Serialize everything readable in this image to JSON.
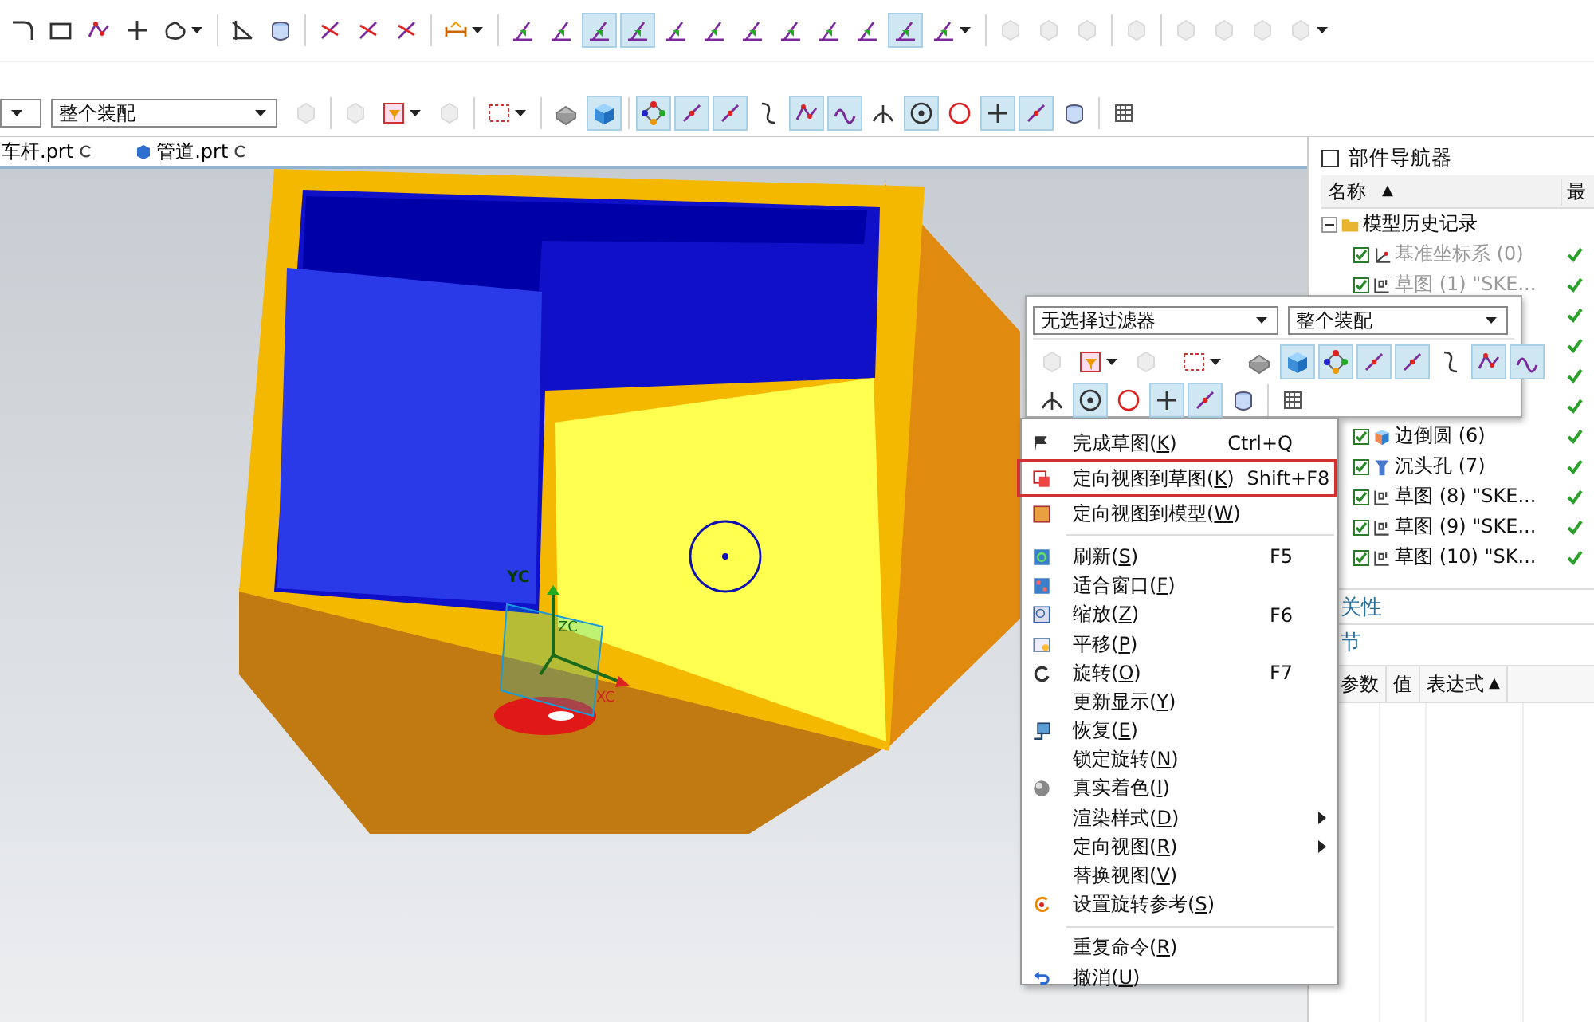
{
  "toolbar": [
    {
      "kind": "corner",
      "pressed": false,
      "disabled": false,
      "menu": false
    },
    {
      "kind": "rect",
      "pressed": false,
      "disabled": false,
      "menu": false
    },
    {
      "kind": "polyline",
      "pressed": false,
      "disabled": false,
      "menu": false
    },
    {
      "kind": "plus",
      "pressed": false,
      "disabled": false,
      "menu": false
    },
    {
      "kind": "blob",
      "pressed": false,
      "disabled": false,
      "menu": true
    },
    {
      "kind": "separator"
    },
    {
      "kind": "angle",
      "pressed": false,
      "disabled": false,
      "menu": false
    },
    {
      "kind": "cylinder",
      "pressed": false,
      "disabled": false,
      "menu": false
    },
    {
      "kind": "separator"
    },
    {
      "kind": "trim",
      "pressed": false,
      "disabled": false,
      "menu": false
    },
    {
      "kind": "trim",
      "pressed": false,
      "disabled": false,
      "menu": false
    },
    {
      "kind": "trim",
      "pressed": false,
      "disabled": false,
      "menu": false
    },
    {
      "kind": "separator"
    },
    {
      "kind": "dimension",
      "pressed": false,
      "disabled": false,
      "menu": true
    },
    {
      "kind": "separator"
    },
    {
      "kind": "sketch",
      "pressed": false,
      "disabled": false,
      "menu": false
    },
    {
      "kind": "sketch",
      "pressed": false,
      "disabled": false,
      "menu": false
    },
    {
      "kind": "sketch",
      "pressed": true,
      "disabled": false,
      "menu": false
    },
    {
      "kind": "sketch",
      "pressed": true,
      "disabled": false,
      "menu": false
    },
    {
      "kind": "sketch",
      "pressed": false,
      "disabled": false,
      "menu": false
    },
    {
      "kind": "sketch",
      "pressed": false,
      "disabled": false,
      "menu": false
    },
    {
      "kind": "sketch",
      "pressed": false,
      "disabled": false,
      "menu": false
    },
    {
      "kind": "sketch",
      "pressed": false,
      "disabled": false,
      "menu": false
    },
    {
      "kind": "sketch",
      "pressed": false,
      "disabled": false,
      "menu": false
    },
    {
      "kind": "sketch",
      "pressed": false,
      "disabled": false,
      "menu": false
    },
    {
      "kind": "sketch",
      "pressed": true,
      "disabled": false,
      "menu": false
    },
    {
      "kind": "sketch",
      "pressed": false,
      "disabled": false,
      "menu": true
    },
    {
      "kind": "separator"
    },
    {
      "kind": "part",
      "pressed": false,
      "disabled": true,
      "menu": false
    },
    {
      "kind": "part",
      "pressed": false,
      "disabled": true,
      "menu": false
    },
    {
      "kind": "part",
      "pressed": false,
      "disabled": true,
      "menu": false
    },
    {
      "kind": "separator"
    },
    {
      "kind": "part",
      "pressed": false,
      "disabled": true,
      "menu": false
    },
    {
      "kind": "separator"
    },
    {
      "kind": "part",
      "pressed": false,
      "disabled": true,
      "menu": false
    },
    {
      "kind": "part",
      "pressed": false,
      "disabled": true,
      "menu": false
    },
    {
      "kind": "part",
      "pressed": false,
      "disabled": true,
      "menu": false
    },
    {
      "kind": "part",
      "pressed": false,
      "disabled": true,
      "menu": true
    }
  ],
  "toolbar2": {
    "assembly": "整个装配",
    "tools": [
      {
        "kind": "part",
        "pressed": false,
        "disabled": true,
        "menu": false
      },
      {
        "kind": "separator"
      },
      {
        "kind": "part",
        "pressed": false,
        "disabled": true,
        "menu": false
      },
      {
        "kind": "filter",
        "pressed": false,
        "disabled": false,
        "menu": true
      },
      {
        "kind": "part",
        "pressed": false,
        "disabled": true,
        "menu": false
      },
      {
        "kind": "separator"
      },
      {
        "kind": "selbox",
        "pressed": false,
        "disabled": false,
        "menu": true
      },
      {
        "kind": "separator"
      },
      {
        "kind": "cubegrey",
        "pressed": false,
        "disabled": false,
        "menu": false
      },
      {
        "kind": "cubeblue",
        "pressed": true,
        "disabled": false,
        "menu": false
      },
      {
        "kind": "separator"
      },
      {
        "kind": "nodes",
        "pressed": true,
        "disabled": false,
        "menu": false
      },
      {
        "kind": "line",
        "pressed": true,
        "disabled": false,
        "menu": false
      },
      {
        "kind": "line",
        "pressed": true,
        "disabled": false,
        "menu": false
      },
      {
        "kind": "curve",
        "pressed": false,
        "disabled": false,
        "menu": false
      },
      {
        "kind": "polyline",
        "pressed": true,
        "disabled": false,
        "menu": false
      },
      {
        "kind": "wave",
        "pressed": true,
        "disabled": false,
        "menu": false
      },
      {
        "kind": "tee",
        "pressed": false,
        "disabled": false,
        "menu": false
      },
      {
        "kind": "circledot",
        "pressed": true,
        "disabled": false,
        "menu": false
      },
      {
        "kind": "circle",
        "pressed": false,
        "disabled": false,
        "menu": false
      },
      {
        "kind": "plus",
        "pressed": true,
        "disabled": false,
        "menu": false
      },
      {
        "kind": "line",
        "pressed": true,
        "disabled": false,
        "menu": false
      },
      {
        "kind": "cylinder",
        "pressed": false,
        "disabled": false,
        "menu": false
      },
      {
        "kind": "separator"
      },
      {
        "kind": "grid",
        "pressed": false,
        "disabled": false,
        "menu": false
      }
    ]
  },
  "tabs": [
    {
      "label": "车杆.prt"
    },
    {
      "label": "管道.prt",
      "kind": "part"
    }
  ],
  "csys_labels": [
    "YC",
    "ZC",
    "XC"
  ],
  "navigator": {
    "title": "部件导航器",
    "columns": [
      {
        "label": "名称",
        "sort_mark": "▲"
      },
      {
        "label": "最"
      }
    ],
    "tree": [
      {
        "label": "模型历史记录",
        "expanded": true,
        "children": [
          {
            "kind": "datum",
            "label": "基准坐标系 (0)",
            "checked": true,
            "dimmed": true,
            "latest": true
          },
          {
            "kind": "sketch",
            "label": "草图 (1) \"SKE...",
            "checked": true,
            "dimmed": true,
            "latest": true
          },
          {
            "latest": true
          },
          {
            "latest": true
          },
          {
            "latest": true
          },
          {
            "latest": true
          },
          {
            "kind": "blend",
            "label": "边倒圆 (6)",
            "checked": true,
            "dimmed": false,
            "latest": true
          },
          {
            "kind": "hole",
            "label": "沉头孔 (7)",
            "checked": true,
            "dimmed": false,
            "latest": true
          },
          {
            "kind": "sketch",
            "label": "草图 (8) \"SKE...",
            "checked": true,
            "dimmed": false,
            "latest": true
          },
          {
            "kind": "sketch",
            "label": "草图 (9) \"SKE...",
            "checked": true,
            "dimmed": false,
            "latest": true
          },
          {
            "kind": "sketch",
            "label": "草图 (10) \"SK...",
            "checked": true,
            "dimmed": false,
            "latest": true
          }
        ]
      }
    ],
    "sections": [
      {
        "label": "关性"
      },
      {
        "label": "节"
      }
    ],
    "details_columns": [
      {
        "label": "参数"
      },
      {
        "label": "值"
      },
      {
        "label": "表达式",
        "sort_mark": "▲"
      }
    ]
  },
  "popup": {
    "filter": "无选择过滤器",
    "assembly": "整个装配",
    "rows": [
      {
        "tools": [
          {
            "kind": "part",
            "pressed": false,
            "disabled": true,
            "menu": false
          },
          {
            "kind": "filter",
            "pressed": false,
            "disabled": false,
            "menu": true
          },
          {
            "kind": "part",
            "pressed": false,
            "disabled": true,
            "menu": false
          },
          {
            "kind": "separator"
          },
          {
            "kind": "selbox",
            "pressed": false,
            "disabled": false,
            "menu": true
          },
          {
            "kind": "separator"
          },
          {
            "kind": "cubegrey",
            "pressed": false,
            "disabled": false,
            "menu": false
          },
          {
            "kind": "cubeblue",
            "pressed": true,
            "disabled": false,
            "menu": false
          },
          {
            "kind": "nodes",
            "pressed": true,
            "disabled": false,
            "menu": false
          },
          {
            "kind": "line",
            "pressed": true,
            "disabled": false,
            "menu": false
          },
          {
            "kind": "line",
            "pressed": true,
            "disabled": false,
            "menu": false
          },
          {
            "kind": "curve",
            "pressed": false,
            "disabled": false,
            "menu": false
          },
          {
            "kind": "polyline",
            "pressed": true,
            "disabled": false,
            "menu": false
          },
          {
            "kind": "wave",
            "pressed": true,
            "disabled": false,
            "menu": false
          }
        ]
      },
      {
        "tools": [
          {
            "kind": "tee",
            "pressed": false,
            "disabled": false,
            "menu": false
          },
          {
            "kind": "circledot",
            "pressed": true,
            "disabled": false,
            "menu": false
          },
          {
            "kind": "circle",
            "pressed": false,
            "disabled": false,
            "menu": false
          },
          {
            "kind": "plus",
            "pressed": true,
            "disabled": false,
            "menu": false
          },
          {
            "kind": "line",
            "pressed": true,
            "disabled": false,
            "menu": false
          },
          {
            "kind": "cylinder",
            "pressed": false,
            "disabled": false,
            "menu": false
          },
          {
            "kind": "separator"
          },
          {
            "kind": "grid",
            "pressed": false,
            "disabled": false,
            "menu": false
          }
        ]
      }
    ]
  },
  "menu": {
    "items": [
      {
        "kind": "item",
        "label": "完成草图(K)",
        "shortcut": "Ctrl+Q",
        "highlighted": false
      },
      {
        "kind": "item",
        "label": "定向视图到草图(K)",
        "shortcut": "Shift+F8",
        "highlighted": true
      },
      {
        "kind": "item",
        "label": "定向视图到模型(W)",
        "highlighted": false
      },
      {
        "kind": "separator"
      },
      {
        "kind": "item",
        "label": "刷新(S)",
        "shortcut": "F5",
        "highlighted": false
      },
      {
        "kind": "item",
        "label": "适合窗口(F)",
        "highlighted": false
      },
      {
        "kind": "item",
        "label": "缩放(Z)",
        "shortcut": "F6",
        "highlighted": false
      },
      {
        "kind": "item",
        "label": "平移(P)",
        "highlighted": false
      },
      {
        "kind": "item",
        "label": "旋转(O)",
        "shortcut": "F7",
        "highlighted": false
      },
      {
        "kind": "item",
        "label": "更新显示(Y)",
        "highlighted": false
      },
      {
        "kind": "item",
        "label": "恢复(E)",
        "highlighted": false
      },
      {
        "kind": "item",
        "label": "锁定旋转(N)",
        "highlighted": false
      },
      {
        "kind": "item",
        "label": "真实着色(I)",
        "highlighted": false
      },
      {
        "kind": "submenu",
        "label": "渲染样式(D)",
        "highlighted": false
      },
      {
        "kind": "submenu",
        "label": "定向视图(R)",
        "highlighted": false
      },
      {
        "kind": "item",
        "label": "替换视图(V)",
        "highlighted": false
      },
      {
        "kind": "item",
        "label": "设置旋转参考(S)",
        "highlighted": false
      },
      {
        "kind": "separator"
      },
      {
        "kind": "item",
        "label": "重复命令(R)",
        "highlighted": false
      },
      {
        "kind": "item",
        "label": "撤消(U)",
        "highlighted": false
      }
    ]
  }
}
